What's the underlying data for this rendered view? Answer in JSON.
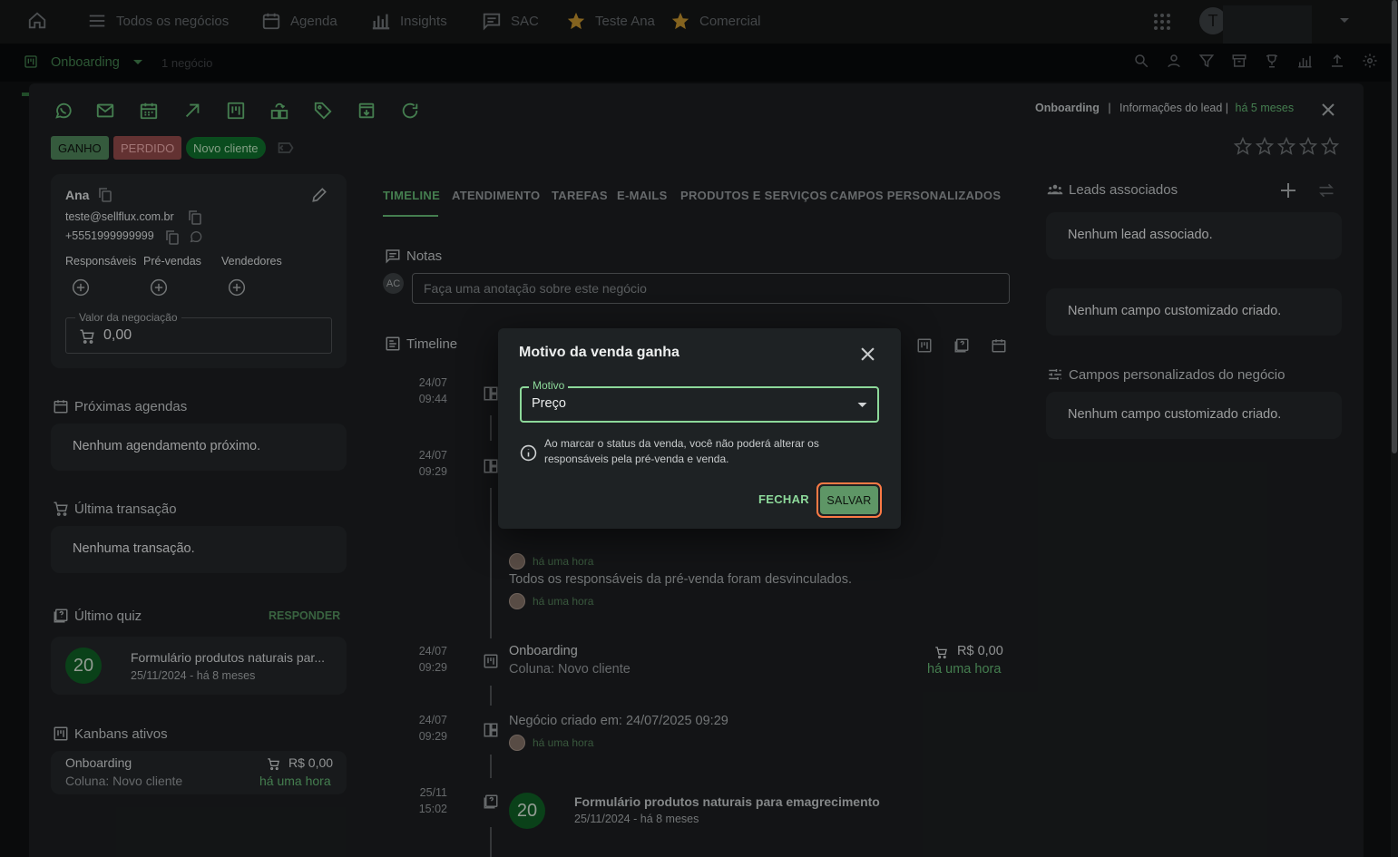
{
  "nav": {
    "items": [
      {
        "label": "Todos os negócios",
        "icon": "menu-icon"
      },
      {
        "label": "Agenda",
        "icon": "calendar-icon"
      },
      {
        "label": "Insights",
        "icon": "bar-chart-icon"
      },
      {
        "label": "SAC",
        "icon": "chat-icon"
      },
      {
        "label": "Teste Ana",
        "icon": "star-icon"
      },
      {
        "label": "Comercial",
        "icon": "star-icon"
      }
    ],
    "avatar_initial": "T"
  },
  "subnav": {
    "board": "Onboarding",
    "count": "1 negócio"
  },
  "panel": {
    "header": {
      "board": "Onboarding",
      "separator": "|",
      "info": "Informações do lead |",
      "time": "há 5 meses"
    },
    "badges": {
      "won": "GANHO",
      "lost": "PERDIDO",
      "stage": "Novo cliente"
    },
    "lead": {
      "name": "Ana",
      "email": "teste@sellflux.com.br",
      "phone": "+5551999999999",
      "roles": [
        "Responsáveis",
        "Pré-vendas",
        "Vendedores"
      ],
      "value_label": "Valor da negociação",
      "value": "0,00"
    },
    "agenda": {
      "title": "Próximas agendas",
      "empty": "Nenhum agendamento próximo."
    },
    "transaction": {
      "title": "Última transação",
      "empty": "Nenhuma transação."
    },
    "quiz": {
      "title": "Último quiz",
      "action": "RESPONDER",
      "score": "20",
      "name": "Formulário produtos naturais par...",
      "date": "25/11/2024 - há 8 meses"
    },
    "kanbans": {
      "title": "Kanbans ativos",
      "board": "Onboarding",
      "column": "Coluna: Novo cliente",
      "value": "R$ 0,00",
      "time": "há uma hora"
    },
    "tabs": [
      "TIMELINE",
      "ATENDIMENTO",
      "TAREFAS",
      "E-MAILS",
      "PRODUTOS E SERVIÇOS",
      "CAMPOS PERSONALIZADOS"
    ],
    "notes": {
      "title": "Notas",
      "avatar": "AC",
      "placeholder": "Faça uma anotação sobre este negócio"
    },
    "timeline": {
      "title": "Timeline",
      "entries": [
        {
          "date": "24/07",
          "time": "09:44"
        },
        {
          "date": "24/07",
          "time": "09:29"
        },
        {
          "date": "24/07",
          "time": "09:29"
        },
        {
          "date": "24/07",
          "time": "09:29"
        },
        {
          "date": "25/11",
          "time": "15:02"
        }
      ],
      "ago1": "há uma hora",
      "unlinked": "Todos os responsáveis da pré-venda foram desvinculados.",
      "ago2": "há uma hora",
      "board": "Onboarding",
      "column": "Coluna: Novo cliente",
      "value": "R$ 0,00",
      "value_time": "há uma hora",
      "created": "Negócio criado em: 24/07/2025 09:29",
      "ago3": "há uma hora",
      "quiz_score": "20",
      "quiz_name": "Formulário produtos naturais para emagrecimento",
      "quiz_date": "25/11/2024 - há 8 meses"
    },
    "right": {
      "leads_title": "Leads associados",
      "leads_empty": "Nenhum lead associado.",
      "fields_empty": "Nenhum campo customizado criado.",
      "deal_fields_title": "Campos personalizados do negócio",
      "deal_fields_empty": "Nenhum campo customizado criado."
    }
  },
  "dialog": {
    "title": "Motivo da venda ganha",
    "field_label": "Motivo",
    "field_value": "Preço",
    "info": "Ao marcar o status da venda, você não poderá alterar os responsáveis pela pré-venda e venda.",
    "close_label": "FECHAR",
    "save_label": "SALVAR"
  },
  "colors": {
    "accent": "#5fae6e",
    "won_badge": "#4a7d55",
    "lost_badge": "#8a4646",
    "stage_badge": "#0f6a2a",
    "dialog_focus": "#8dd99a",
    "save_highlight": "#ff7a45"
  }
}
